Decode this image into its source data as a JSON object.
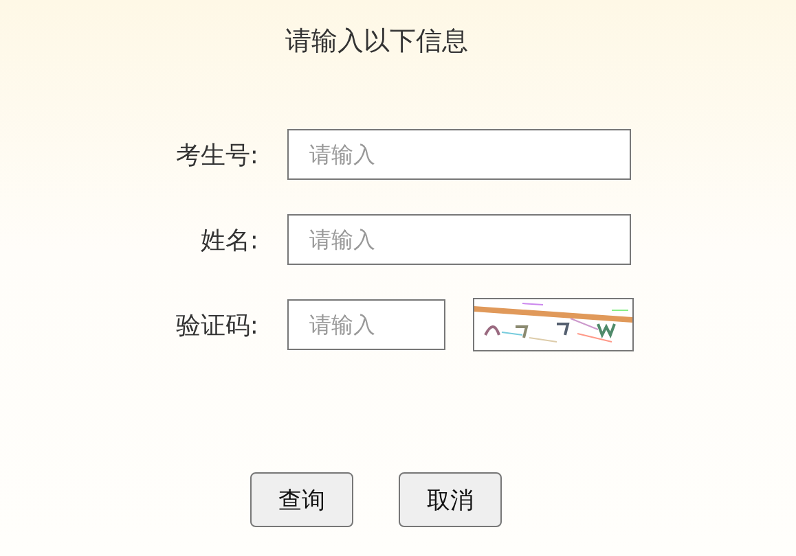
{
  "title": "请输入以下信息",
  "fields": [
    {
      "kind": "text",
      "label": "考生号:",
      "placeholder": "请输入"
    },
    {
      "kind": "text",
      "label": "姓名:",
      "placeholder": "请输入"
    },
    {
      "kind": "captcha",
      "label": "验证码:",
      "placeholder": "请输入"
    }
  ],
  "buttons": [
    "查询",
    "取消"
  ]
}
